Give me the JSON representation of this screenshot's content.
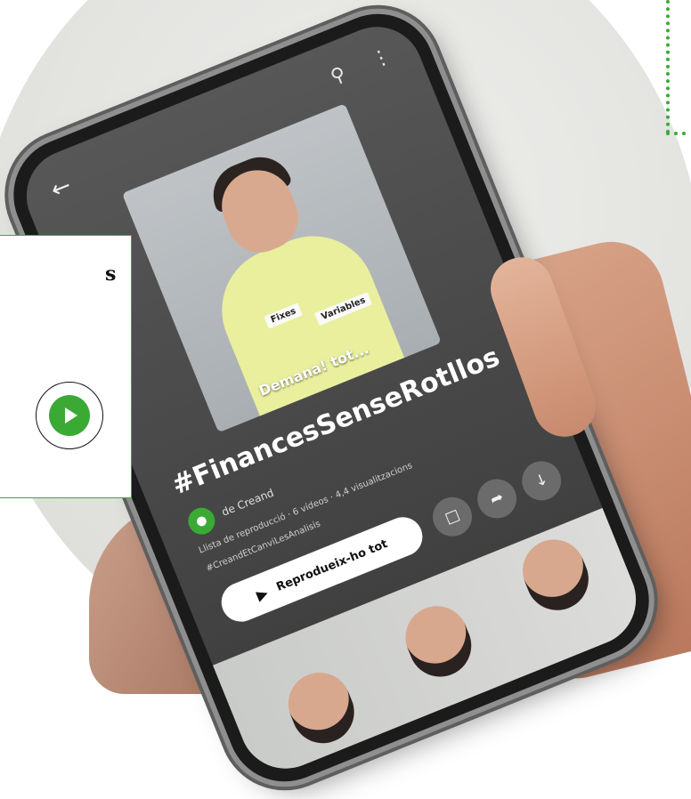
{
  "colors": {
    "accent": "#3aaa35",
    "card_border": "#3aaa35"
  },
  "overlay": {
    "text_fragment": "s",
    "play_icon": "play-icon"
  },
  "phone": {
    "back_icon": "arrow-left-icon",
    "search_icon": "search-icon",
    "more_icon": "more-vert-icon",
    "thumbnail": {
      "card_1": "Fixes",
      "card_2": "Variables",
      "caption": "Demana! tot..."
    },
    "playlist_title": "#FinancesSenseRotllos",
    "channel_name": "de Creand",
    "meta": "Llista de reproducció · 6 vídeos · 4,4 visualitzacions",
    "tags": "#CreandEtCanviLesAnalisis",
    "play_all_label": "Reprodueix-ho tot",
    "actions": [
      "bookmark-icon",
      "share-icon",
      "download-icon"
    ]
  }
}
